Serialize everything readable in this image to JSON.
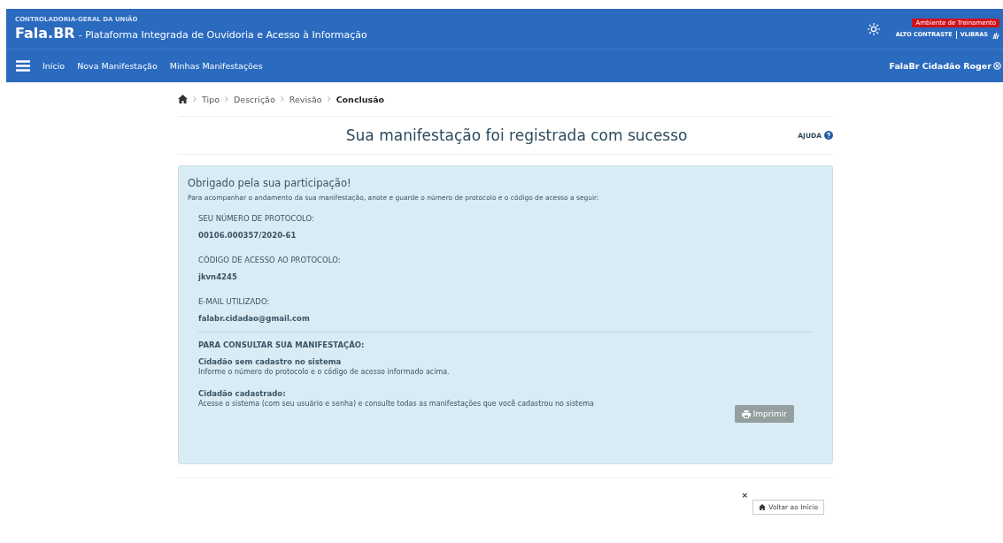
{
  "header": {
    "org": "CONTROLADORIA-GERAL DA UNIÃO",
    "brand": "Fala.BR",
    "subtitle": "- Plataforma Integrada de Ouvidoria e Acesso à Informação",
    "badge": "Ambiente de Treinamento",
    "links": [
      "ALTO CONTRASTE",
      "VLIBRAS"
    ]
  },
  "nav": {
    "items": [
      "Início",
      "Nova Manifestação",
      "Minhas Manifestações"
    ],
    "user": "FalaBr Cidadão Roger"
  },
  "breadcrumb": [
    {
      "label": "Tipo",
      "selected": false
    },
    {
      "label": "Descrição",
      "selected": false
    },
    {
      "label": "Revisão",
      "selected": false
    },
    {
      "label": "Conclusão",
      "selected": true
    }
  ],
  "title": "Sua manifestação foi registrada com sucesso",
  "help": "AJUDA",
  "panel": {
    "heading": "Obrigado pela sua participação!",
    "intro": "Para acompanhar o andamento da sua manifestação, anote e guarde o número de protocolo e o código de acesso a seguir:",
    "fields": [
      {
        "label": "SEU NÚMERO DE PROTOCOLO:",
        "value": "00106.000357/2020-61"
      },
      {
        "label": "CÓDIGO DE ACESSO AO PROTOCOLO:",
        "value": "jkvn4245"
      },
      {
        "label": "E-MAIL UTILIZADO:",
        "value": "falabr.cidadao@gmail.com"
      }
    ],
    "consult_heading": "PARA CONSULTAR SUA MANIFESTAÇÃO:",
    "cases": [
      {
        "title": "Cidadão sem cadastro no sistema",
        "text": "Informe o número do protocolo e o código de acesso informado acima."
      },
      {
        "title": "Cidadão cadastrado:",
        "text": "Acesse o sistema (com seu usuário e senha) e consulte todas as manifestações que você cadastrou no sistema"
      }
    ],
    "print_button": "Imprimir"
  },
  "footer": {
    "close": "×",
    "back_button": "Voltar ao Início"
  }
}
